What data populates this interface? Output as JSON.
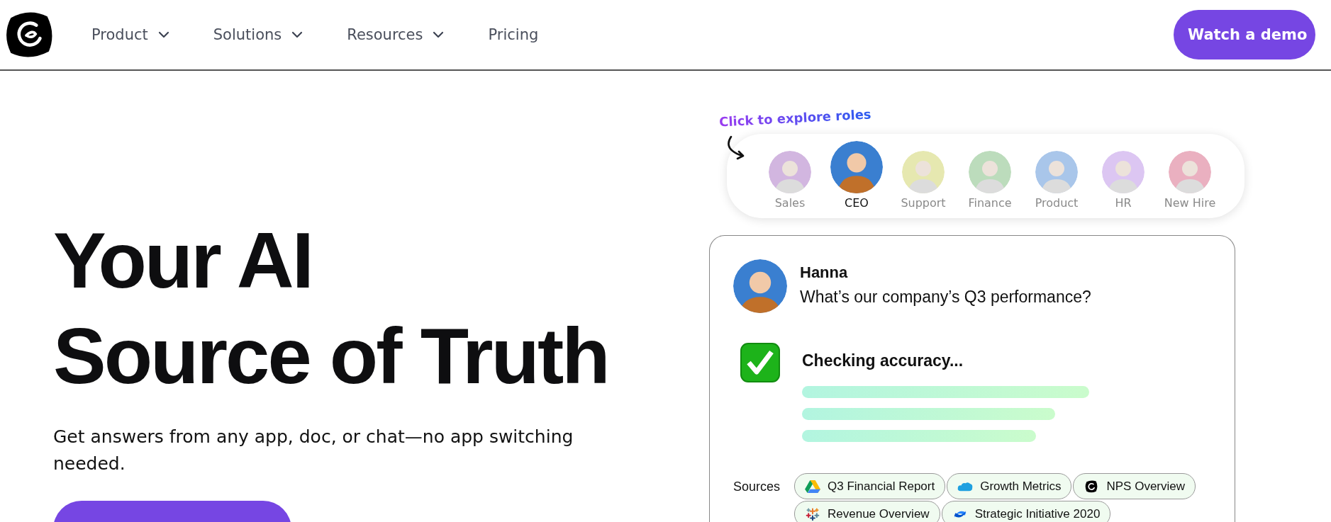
{
  "nav": {
    "items": [
      {
        "label": "Product",
        "has_menu": true
      },
      {
        "label": "Solutions",
        "has_menu": true
      },
      {
        "label": "Resources",
        "has_menu": true
      },
      {
        "label": "Pricing",
        "has_menu": false
      }
    ],
    "cta": "Watch a demo"
  },
  "hero": {
    "title_lines": [
      "Your AI",
      "Source of Truth"
    ],
    "subtitle": "Get answers from any app, doc, or chat—no app switching needed."
  },
  "roles": {
    "hint": "Click to explore roles",
    "items": [
      {
        "label": "Sales",
        "selected": false,
        "color": "#d2b6e0"
      },
      {
        "label": "CEO",
        "selected": true,
        "color": "#3a7fd0"
      },
      {
        "label": "Support",
        "selected": false,
        "color": "#e6e8b0"
      },
      {
        "label": "Finance",
        "selected": false,
        "color": "#bcdcbc"
      },
      {
        "label": "Product",
        "selected": false,
        "color": "#a9c6ea"
      },
      {
        "label": "HR",
        "selected": false,
        "color": "#dcc6f2"
      },
      {
        "label": "New Hire",
        "selected": false,
        "color": "#eab0c0"
      }
    ]
  },
  "chat": {
    "user": "Hanna",
    "question": "What’s our company’s Q3 performance?",
    "status": "Checking accuracy...",
    "sources_label": "Sources",
    "sources": [
      {
        "label": "Q3 Financial Report"
      },
      {
        "label": "Growth Metrics"
      },
      {
        "label": "NPS Overview"
      },
      {
        "label": "Revenue Overview"
      },
      {
        "label": "Strategic Initiative 2020"
      }
    ]
  }
}
